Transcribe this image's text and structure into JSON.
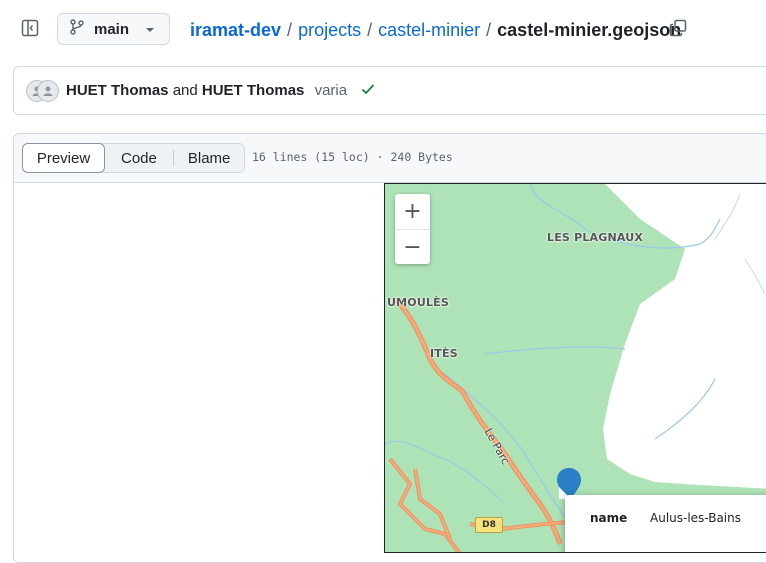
{
  "header": {
    "branch": "main",
    "breadcrumb": {
      "owner": "iramat-dev",
      "path": [
        "projects",
        "castel-minier"
      ],
      "file": "castel-minier.geojson",
      "separator": "/"
    },
    "icons": [
      "sidebar-toggle-icon",
      "git-branch-icon",
      "caret-down-icon",
      "copy-icon"
    ]
  },
  "commit": {
    "author_1": "HUET Thomas",
    "conjunction": "and",
    "author_2": "HUET Thomas",
    "message": "varia",
    "status": "success",
    "status_color": "#1a7f37"
  },
  "file_view": {
    "tabs": [
      "Preview",
      "Code",
      "Blame"
    ],
    "active_tab": "Preview",
    "meta": "16 lines (15 loc) · 240 Bytes"
  },
  "map": {
    "zoom_in": "+",
    "zoom_out": "−",
    "places": [
      "LES PLAGNAUX",
      "UMOULÈS",
      "ITÈS"
    ],
    "road_name": "Le Parc",
    "road_shield": "D8",
    "popup": {
      "key": "name",
      "value": "Aulus-les-Bains"
    },
    "colors": {
      "forest": "#aee3b7",
      "road": "#f5a978",
      "water": "#9cc7ec",
      "marker": "#2a7fc6"
    }
  },
  "accent_color": "#0969da"
}
